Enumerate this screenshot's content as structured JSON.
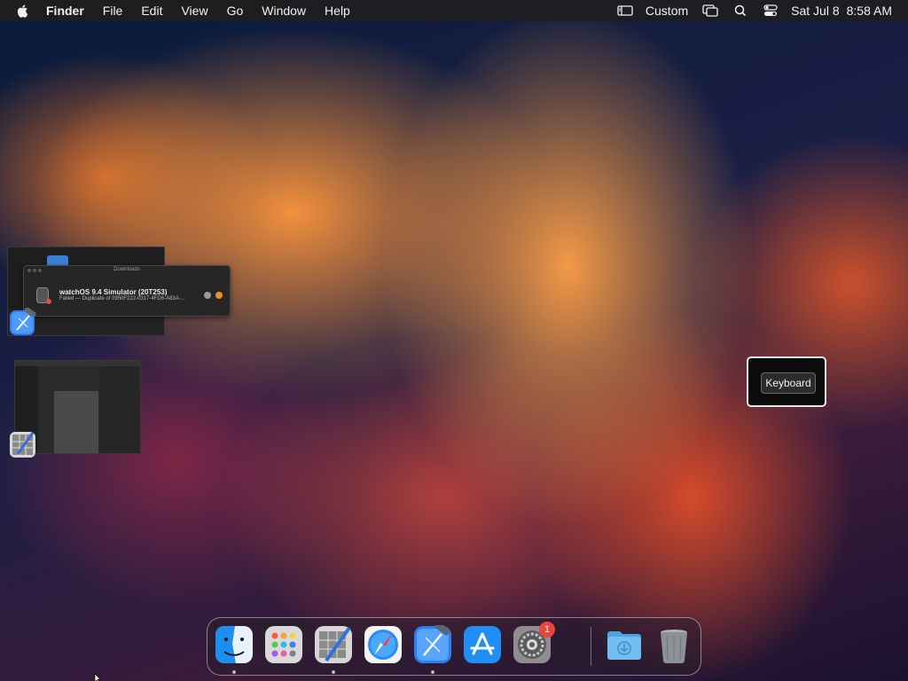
{
  "menubar": {
    "app_name": "Finder",
    "menus": [
      "File",
      "Edit",
      "View",
      "Go",
      "Window",
      "Help"
    ],
    "status": {
      "input_source": "Custom",
      "date": "Sat Jul 8",
      "time": "8:58 AM"
    },
    "icons": [
      "apple-icon",
      "display-icon",
      "screen-mirroring-icon",
      "spotlight-search-icon",
      "control-center-icon"
    ]
  },
  "downloads_window": {
    "title": "Downloads",
    "item_name": "watchOS 9.4 Simulator (20T253)",
    "item_status": "Failed — Duplicate of 0950F222-0317-4FD6-A83A-..."
  },
  "keyboard_panel": {
    "button_label": "Keyboard"
  },
  "dock": {
    "items": [
      {
        "name": "Finder",
        "icon": "finder-icon",
        "running": true
      },
      {
        "name": "Launchpad",
        "icon": "launchpad-icon",
        "running": false
      },
      {
        "name": "Instruments / Editor",
        "icon": "xcode-editor-icon",
        "running": true
      },
      {
        "name": "Safari",
        "icon": "safari-icon",
        "running": false
      },
      {
        "name": "Xcode",
        "icon": "xcode-icon",
        "running": true
      },
      {
        "name": "App Store",
        "icon": "app-store-icon",
        "running": false
      },
      {
        "name": "System Settings",
        "icon": "system-settings-icon",
        "running": false,
        "badge": "1"
      },
      {
        "name": "Downloads",
        "icon": "downloads-folder-icon",
        "running": false
      },
      {
        "name": "Trash",
        "icon": "trash-icon",
        "running": false
      }
    ]
  },
  "colors": {
    "menubar_bg": "#1e1e1e",
    "badge_red": "#e8453c",
    "accent_blue": "#2f7df6"
  }
}
